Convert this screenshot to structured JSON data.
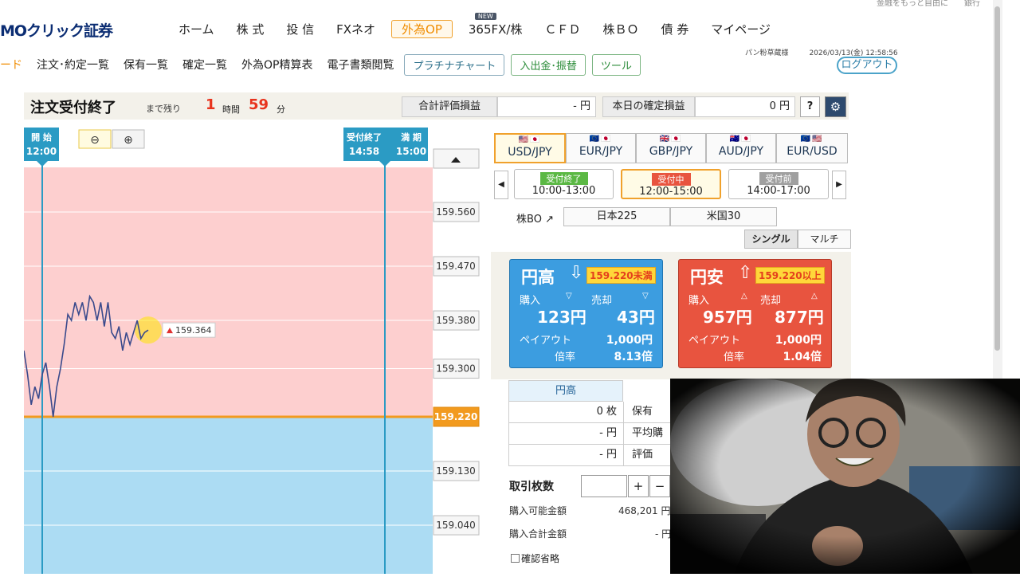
{
  "header": {
    "logo": "MOクリック証券",
    "top_links": "金融をもっと自由に　　銀行",
    "nav": [
      {
        "label": "ホーム"
      },
      {
        "label": "株 式"
      },
      {
        "label": "投 信"
      },
      {
        "label": "FXネオ"
      },
      {
        "label": "外為OP"
      },
      {
        "label": "365FX/株"
      },
      {
        "label": "ＣＦＤ"
      },
      {
        "label": "株ＢＯ"
      },
      {
        "label": "債 券"
      },
      {
        "label": "マイページ"
      }
    ],
    "new_badge": "NEW"
  },
  "subnav": {
    "items": [
      "ード",
      "注文･約定一覧",
      "保有一覧",
      "確定一覧",
      "外為OP精算表",
      "電子書類閲覧"
    ],
    "platinum_chart": "プラチナチャート",
    "deposit": "入出金･振替",
    "tools": "ツール",
    "user_name": "パン粉草蔵様",
    "datetime": "2026/03/13(金) 12:58:56",
    "logout": "ログアウト"
  },
  "status": {
    "title": "注文受付終了",
    "remaining_label": "まで残り",
    "hours": "1",
    "hours_unit": "時間",
    "minutes": "59",
    "minutes_unit": "分",
    "total_pl_label": "合計評価損益",
    "total_pl_value": "- 円",
    "today_pl_label": "本日の確定損益",
    "today_pl_value": "0 円",
    "help": "?"
  },
  "chart_data": {
    "type": "line",
    "start_label": "開 始",
    "start_time": "12:00",
    "close_label": "受付終了",
    "close_time": "14:58",
    "expiry_label": "満 期",
    "expiry_time": "15:00",
    "y_ticks": [
      "159.560",
      "159.470",
      "159.380",
      "159.300",
      "159.220",
      "159.130",
      "159.040"
    ],
    "strike": "159.220",
    "current_price": "159.364",
    "ylim": [
      159.0,
      159.63
    ],
    "price_series": [
      159.33,
      159.29,
      159.24,
      159.27,
      159.25,
      159.29,
      159.31,
      159.27,
      159.22,
      159.27,
      159.3,
      159.34,
      159.39,
      159.38,
      159.41,
      159.39,
      159.41,
      159.38,
      159.42,
      159.41,
      159.38,
      159.41,
      159.37,
      159.41,
      159.36,
      159.35,
      159.37,
      159.33,
      159.36,
      159.34,
      159.36,
      159.38,
      159.35,
      159.36,
      159.364
    ]
  },
  "pairs": [
    {
      "flags": "🇺🇸🇯🇵",
      "label": "USD/JPY"
    },
    {
      "flags": "🇪🇺🇯🇵",
      "label": "EUR/JPY"
    },
    {
      "flags": "🇬🇧🇯🇵",
      "label": "GBP/JPY"
    },
    {
      "flags": "🇦🇺🇯🇵",
      "label": "AUD/JPY"
    },
    {
      "flags": "🇪🇺🇺🇸",
      "label": "EUR/USD"
    }
  ],
  "slots": [
    {
      "badge": "受付終了",
      "time": "10:00-13:00",
      "badge_color": "#5bb844"
    },
    {
      "badge": "受付中",
      "time": "12:00-15:00",
      "badge_color": "#e8543f"
    },
    {
      "badge": "受付前",
      "time": "14:00-17:00",
      "badge_color": "#a0a0a0"
    }
  ],
  "stock_bo": {
    "label": "株BO",
    "arrow": "↗",
    "nikkei": "日本225",
    "us30": "米国30"
  },
  "modes": {
    "single": "シングル",
    "multi": "マルチ"
  },
  "high_card": {
    "title": "円高",
    "arrow": "⇩",
    "condition": "159.220未満",
    "buy_label": "購入",
    "buy_price": "123円",
    "sell_label": "売却",
    "sell_price": "43円",
    "payout_label": "ペイアウト",
    "payout_value": "1,000円",
    "ratio_label": "倍率",
    "ratio_value": "8.13倍"
  },
  "low_card": {
    "title": "円安",
    "arrow": "⇧",
    "condition": "159.220以上",
    "buy_label": "購入",
    "buy_price": "957円",
    "sell_label": "売却",
    "sell_price": "877円",
    "payout_label": "ペイアウト",
    "payout_value": "1,000円",
    "ratio_label": "倍率",
    "ratio_value": "1.04倍"
  },
  "position": {
    "header": "円高",
    "rows": [
      {
        "value": "0 枚",
        "label": "保有"
      },
      {
        "value": "- 円",
        "label": "平均購"
      },
      {
        "value": "- 円",
        "label": "評価"
      }
    ]
  },
  "order": {
    "qty_label": "取引枚数",
    "plus": "+",
    "minus": "−",
    "available_label": "購入可能金額",
    "available_value": "468,201 円",
    "total_label": "購入合計金額",
    "total_value": "- 円",
    "confirm_label": "確認省略"
  }
}
